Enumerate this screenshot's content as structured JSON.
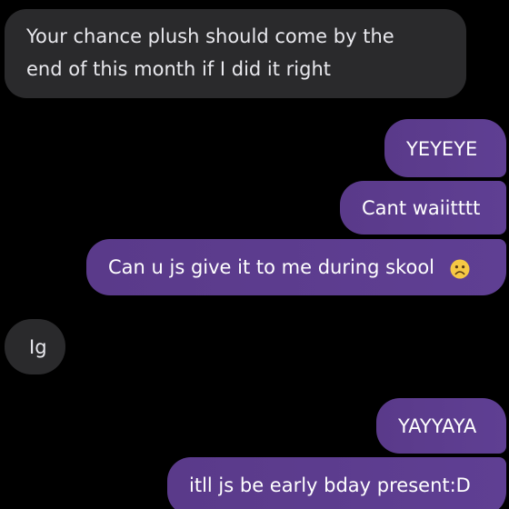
{
  "conversation": {
    "messages": [
      {
        "direction": "incoming",
        "lines": [
          "Your chance plush should come by the",
          "end of this month if I did it right"
        ]
      },
      {
        "direction": "outgoing",
        "text": "YEYEYE"
      },
      {
        "direction": "outgoing",
        "text": "Cant waiitttt"
      },
      {
        "direction": "outgoing",
        "text": "Can u js give it to me during skool",
        "emoji": "frowning-face-emoji"
      },
      {
        "direction": "incoming",
        "text": "Ig"
      },
      {
        "direction": "outgoing",
        "text": "YAYYAYA"
      },
      {
        "direction": "outgoing",
        "text": "itll js be early bday present:D"
      }
    ]
  },
  "colors": {
    "background": "#000000",
    "incoming_bubble": "#2a2a2c",
    "outgoing_bubble": "#5b3b8c",
    "emoji_face": "#f6c844"
  }
}
